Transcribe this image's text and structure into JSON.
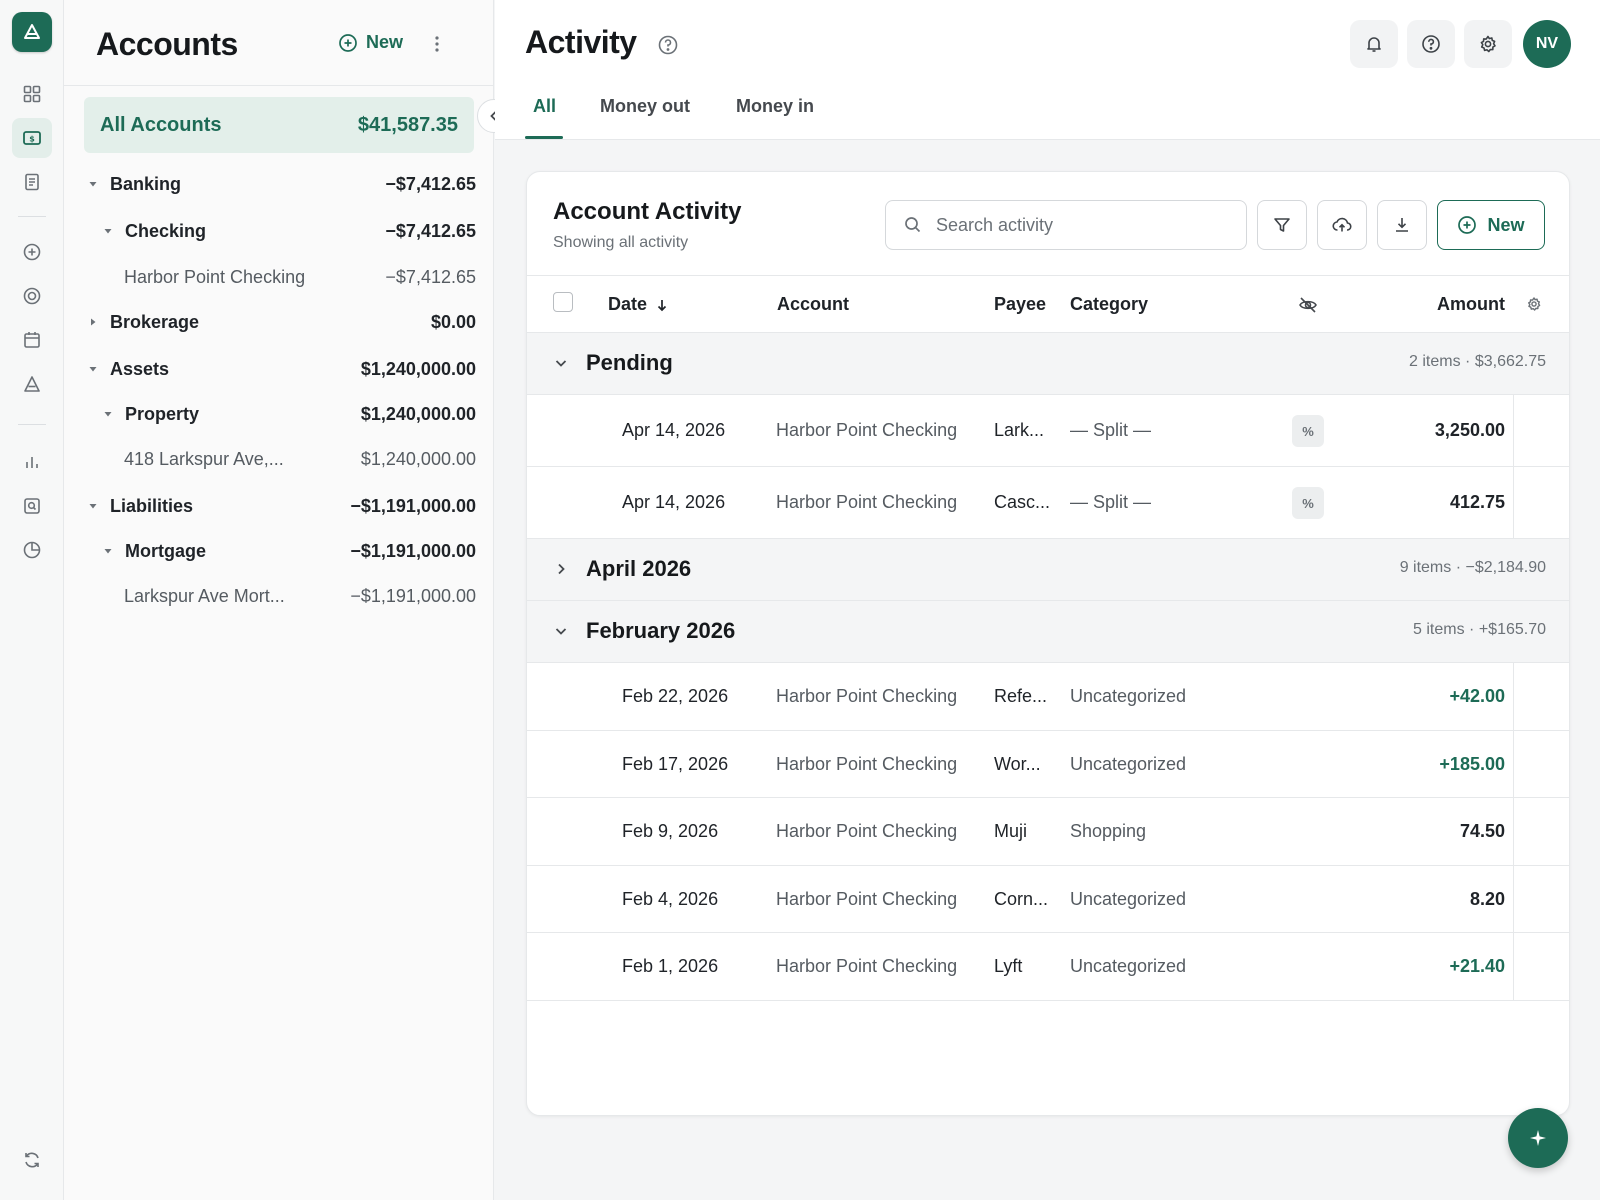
{
  "rail": {
    "icons": [
      "logo-icon",
      "dashboard-icon",
      "accounts-icon",
      "reports-icon",
      "add-icon",
      "budget-icon",
      "calendar-icon",
      "goals-icon",
      "chart-icon",
      "search-doc-icon",
      "history-icon",
      "sync-icon"
    ]
  },
  "accounts": {
    "title": "Accounts",
    "new_label": "New",
    "all": {
      "label": "All Accounts",
      "amount": "$41,587.35"
    },
    "tree": [
      {
        "name": "Banking",
        "amount": "−$7,412.65",
        "level": 0,
        "caret": "down"
      },
      {
        "name": "Checking",
        "amount": "−$7,412.65",
        "level": 1,
        "caret": "down"
      },
      {
        "name": "Harbor Point Checking",
        "amount": "−$7,412.65",
        "level": 2
      },
      {
        "name": "Brokerage",
        "amount": "$0.00",
        "level": 0,
        "caret": "right"
      },
      {
        "name": "Assets",
        "amount": "$1,240,000.00",
        "level": 0,
        "caret": "down"
      },
      {
        "name": "Property",
        "amount": "$1,240,000.00",
        "level": 1,
        "caret": "down"
      },
      {
        "name": "418 Larkspur Ave,...",
        "amount": "$1,240,000.00",
        "level": 2
      },
      {
        "name": "Liabilities",
        "amount": "−$1,191,000.00",
        "level": 0,
        "caret": "down"
      },
      {
        "name": "Mortgage",
        "amount": "−$1,191,000.00",
        "level": 1,
        "caret": "down"
      },
      {
        "name": "Larkspur Ave Mort...",
        "amount": "−$1,191,000.00",
        "level": 2
      }
    ]
  },
  "header": {
    "title": "Activity",
    "avatar_initials": "NV",
    "tabs": [
      {
        "label": "All",
        "active": true
      },
      {
        "label": "Money out",
        "active": false
      },
      {
        "label": "Money in",
        "active": false
      }
    ]
  },
  "card": {
    "title": "Account Activity",
    "subtitle": "Showing all activity",
    "search_placeholder": "Search activity",
    "new_label": "New",
    "columns": {
      "date": "Date",
      "account": "Account",
      "payee": "Payee",
      "category": "Category",
      "amount": "Amount"
    },
    "groups": [
      {
        "name": "Pending",
        "summary": "2 items · $3,662.75",
        "expanded": true
      },
      {
        "name": "April 2026",
        "summary": "9 items · −$2,184.90",
        "expanded": false
      },
      {
        "name": "February 2026",
        "summary": "5 items · +$165.70",
        "expanded": true
      }
    ],
    "pending_rows": [
      {
        "date": "Apr 14, 2026",
        "account": "Harbor Point Checking",
        "payee": "Lark...",
        "category": "— Split —",
        "amount": "3,250.00",
        "positive": false
      },
      {
        "date": "Apr 14, 2026",
        "account": "Harbor Point Checking",
        "payee": "Casc...",
        "category": "— Split —",
        "amount": "412.75",
        "positive": false
      }
    ],
    "feb_rows": [
      {
        "date": "Feb 22, 2026",
        "account": "Harbor Point Checking",
        "payee": "Refe...",
        "category": "Uncategorized",
        "amount": "+42.00",
        "positive": true
      },
      {
        "date": "Feb 17, 2026",
        "account": "Harbor Point Checking",
        "payee": "Wor...",
        "category": "Uncategorized",
        "amount": "+185.00",
        "positive": true
      },
      {
        "date": "Feb 9, 2026",
        "account": "Harbor Point Checking",
        "payee": "Muji",
        "category": "Shopping",
        "amount": "74.50",
        "positive": false
      },
      {
        "date": "Feb 4, 2026",
        "account": "Harbor Point Checking",
        "payee": "Corn...",
        "category": "Uncategorized",
        "amount": "8.20",
        "positive": false
      },
      {
        "date": "Feb 1, 2026",
        "account": "Harbor Point Checking",
        "payee": "Lyft",
        "category": "Uncategorized",
        "amount": "+21.40",
        "positive": true
      }
    ],
    "split_badge": "%"
  },
  "colors": {
    "accent": "#1d6b56",
    "accent_soft": "#e3efea",
    "positive": "#1d6b56"
  }
}
